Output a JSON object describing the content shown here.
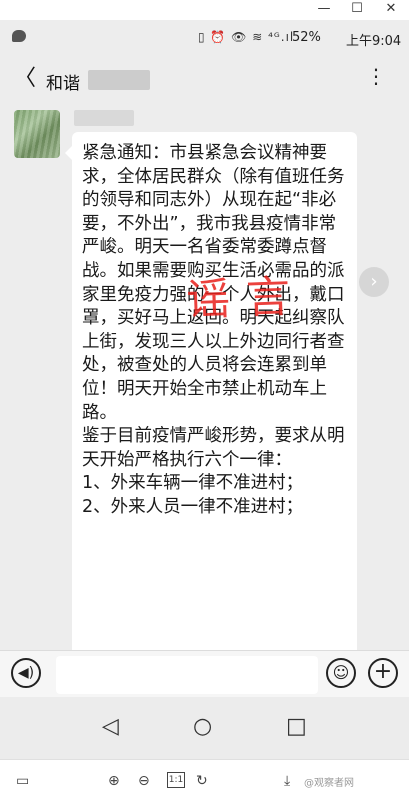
{
  "window": {
    "minimize": "—",
    "maximize": "☐",
    "close": "✕"
  },
  "status_bar": {
    "icons_text": "▯ ⏰ 👁 ≋ ⁴ᴳ.ıl",
    "battery": "52%",
    "time": "上午9:04"
  },
  "chat_header": {
    "back_glyph": "〈",
    "title": "和谐",
    "more_glyph": "⋮"
  },
  "message": {
    "text": "紧急通知：市县紧急会议精神要求，全体居民群众（除有值班任务的领导和同志外）从现在起“非必要，不外出”，我市我县疫情非常严峻。明天一名省委常委蹲点督战。如果需要购买生活必需品的派家里免疫力强的一个人外出，戴口罩，买好马上返回。明天起纠察队上街，发现三人以上外边同行者查处，被查处的人员将会连累到单位！明天开始全市禁止机动车上路。\n鉴于目前疫情严峻形势，要求从明天开始严格执行六个一律：\n1、外来车辆一律不准进村；\n2、外来人员一律不准进村；",
    "stamp": "谣言"
  },
  "input_bar": {
    "voice_glyph": "◀))",
    "emoji_glyph": "☺",
    "plus_glyph": "+"
  },
  "nav_bar": {
    "back": "◁",
    "home": "○",
    "recents": "□"
  },
  "viewer_toolbar": {
    "zoom_in": "⊕",
    "zoom_out": "⊖",
    "actual_size": "1:1",
    "rotate": "↻",
    "download": "⤓",
    "watermark": "@观察者网"
  },
  "colors": {
    "stamp": "#e8201c",
    "bubble": "#ffffff",
    "background": "#ededed"
  }
}
